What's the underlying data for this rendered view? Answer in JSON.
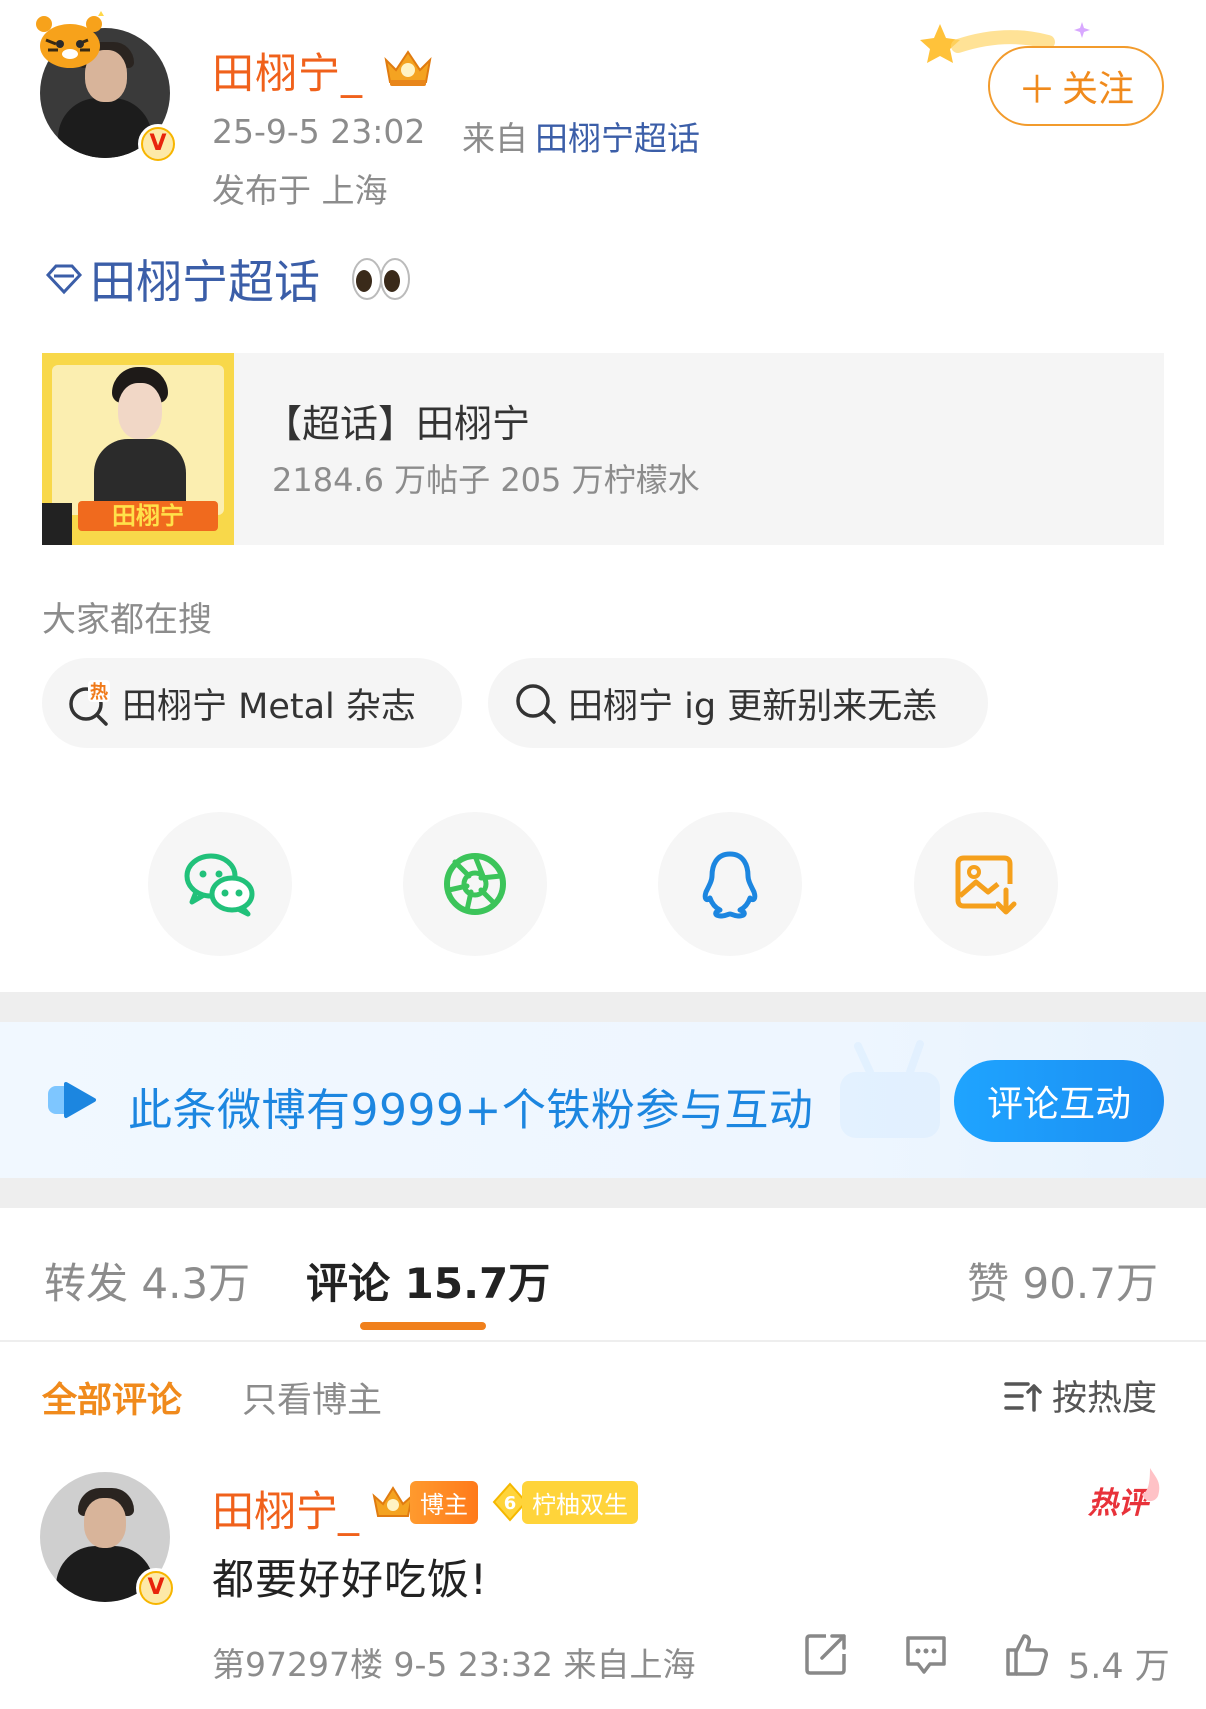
{
  "post": {
    "author_name": "田栩宁_",
    "time": "25-9-5 23:02",
    "source_prefix": "来自",
    "source_link": "田栩宁超话",
    "location": "发布于 上海",
    "follow_label": "关注",
    "topic": "田栩宁超话"
  },
  "topic_card": {
    "title": "【超话】田栩宁",
    "stats": "2184.6 万帖子 205 万柠檬水",
    "thumb_label": "田栩宁"
  },
  "searches": {
    "heading": "大家都在搜",
    "items": [
      {
        "label": "田栩宁 Metal 杂志",
        "icon": "hot-search-icon"
      },
      {
        "label": "田栩宁 ig 更新别来无恙",
        "icon": "search-icon"
      }
    ]
  },
  "share": [
    {
      "icon": "wechat-icon"
    },
    {
      "icon": "moments-icon"
    },
    {
      "icon": "qq-icon"
    },
    {
      "icon": "save-image-icon"
    }
  ],
  "banner": {
    "text": "此条微博有9999+个铁粉参与互动",
    "button": "评论互动"
  },
  "tabs": {
    "repost": "转发 4.3万",
    "comment": "评论 15.7万",
    "like": "赞 90.7万"
  },
  "filters": {
    "all": "全部评论",
    "owner_only": "只看博主",
    "sort": "按热度"
  },
  "comment": {
    "author_name": "田栩宁_",
    "owner_badge": "博主",
    "fan_badge": "柠柚双生",
    "fan_level": "6",
    "hot_label": "热评",
    "text": "都要好好吃饭!",
    "meta": "第97297楼  9-5 23:32  来自上海",
    "like_count": "5.4 万"
  },
  "colors": {
    "name_orange": "#f0611b",
    "link_blue": "#3b5ea8",
    "accent_orange": "#f08a1c",
    "banner_blue": "#1c86e0"
  }
}
